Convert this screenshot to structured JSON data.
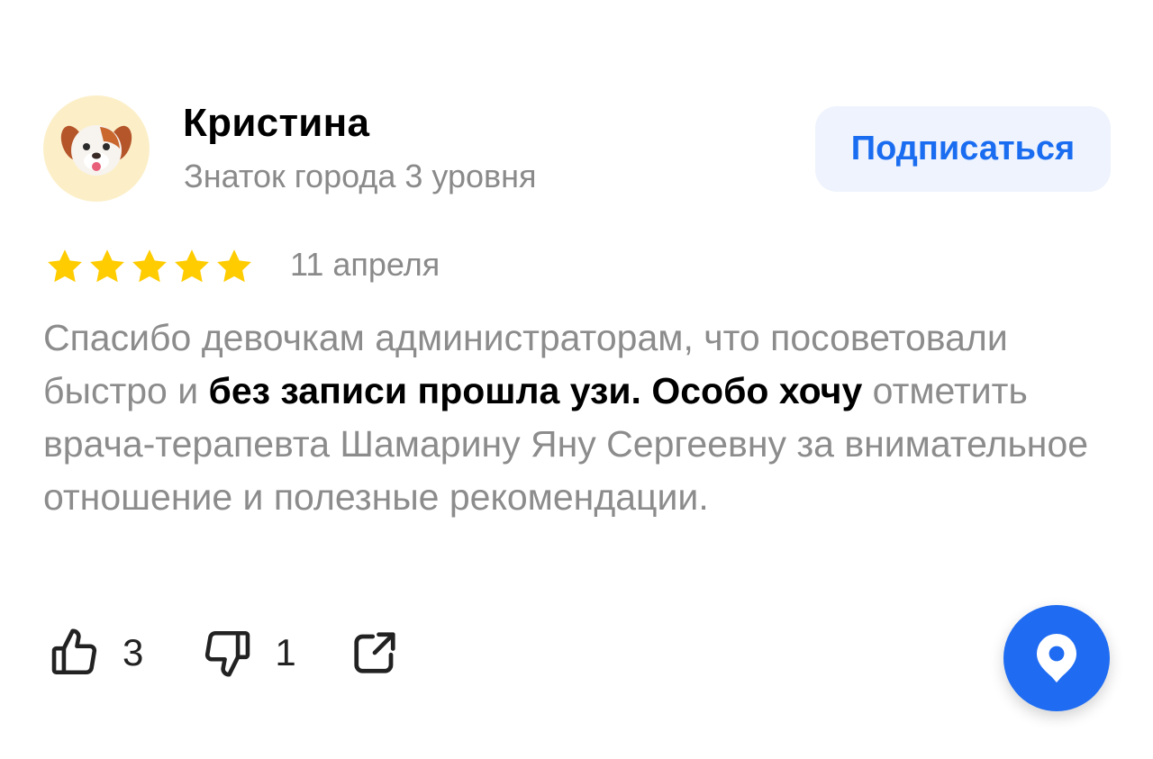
{
  "author": {
    "name": "Кристина",
    "level": "Знаток города 3 уровня",
    "avatar_icon": "puppy-emoji-icon"
  },
  "subscribe": {
    "label": "Подписаться"
  },
  "review": {
    "rating": 5,
    "rating_max": 5,
    "date": "11 апреля",
    "text_part1": "Спасибо девочкам администраторам, что посоветовали быстро и ",
    "text_highlight1": "без записи прошла узи.",
    "text_part2": " ",
    "text_highlight2": "Особо хочу",
    "text_part3": " отметить врача-терапевта Шамарину Яну Сергеевну за внимательное отношение и полезные рекомендации."
  },
  "actions": {
    "likes": "3",
    "dislikes": "1",
    "like_icon": "thumbs-up-icon",
    "dislike_icon": "thumbs-down-icon",
    "share_icon": "share-icon"
  },
  "map_button": {
    "icon": "map-pin-icon"
  },
  "colors": {
    "accent": "#1f6cf2",
    "subscribe_text": "#1a6df0",
    "star": "#ffcc00",
    "muted_text": "#8c8c8c"
  }
}
